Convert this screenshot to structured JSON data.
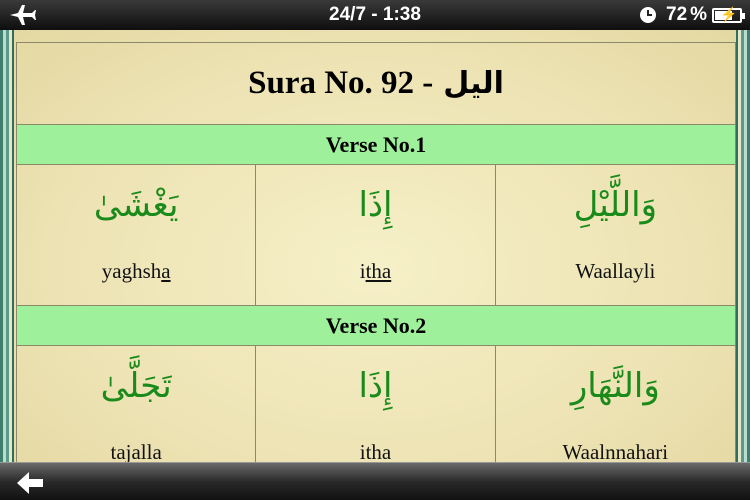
{
  "status_bar": {
    "time": "24/7 - 1:38",
    "battery_percent": "72",
    "battery_symbol": "%",
    "battery_level": 0.72,
    "icons": [
      "airplane-icon",
      "clock-icon",
      "battery-charging-icon"
    ]
  },
  "sura": {
    "title_prefix": "Sura No. 92 -",
    "title_arabic": "الیل"
  },
  "verses": [
    {
      "header": "Verse No.1",
      "words": [
        {
          "arabic": "يَغْشَىٰ",
          "translit_parts": [
            {
              "t": "yaghsh",
              "u": false
            },
            {
              "t": "a",
              "u": true
            }
          ]
        },
        {
          "arabic": "إِذَا",
          "translit_parts": [
            {
              "t": "i",
              "u": false
            },
            {
              "t": "tha",
              "u": true
            }
          ]
        },
        {
          "arabic": "وَاللَّيْلِ",
          "translit_parts": [
            {
              "t": "Waallayli",
              "u": false
            }
          ]
        }
      ]
    },
    {
      "header": "Verse No.2",
      "words": [
        {
          "arabic": "تَجَلَّىٰ",
          "translit_parts": [
            {
              "t": "tajalla",
              "u": false
            }
          ]
        },
        {
          "arabic": "إِذَا",
          "translit_parts": [
            {
              "t": "itha",
              "u": false
            }
          ]
        },
        {
          "arabic": "وَالنَّهَارِ",
          "translit_parts": [
            {
              "t": "Waalnnahari",
              "u": false
            }
          ]
        }
      ]
    }
  ],
  "toolbar": {
    "back_icon": "back-arrow-icon"
  },
  "colors": {
    "verse_header_bg": "#9ef09a",
    "arabic_text": "#1a8a1a",
    "page_bg": "#efe6b8"
  }
}
